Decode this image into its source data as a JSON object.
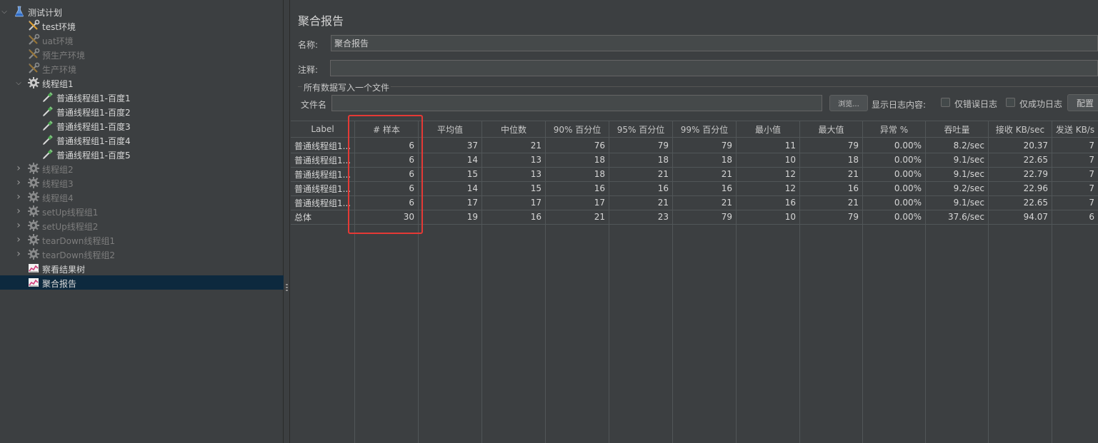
{
  "tree": {
    "items": [
      {
        "label": "测试计划",
        "icon": "flask-icon",
        "level": 0,
        "expanded": true,
        "disabled": false
      },
      {
        "label": "test环境",
        "icon": "wrench-screwdriver-icon",
        "level": 1,
        "disabled": false
      },
      {
        "label": "uat环境",
        "icon": "wrench-screwdriver-icon",
        "level": 1,
        "disabled": true
      },
      {
        "label": "预生产环境",
        "icon": "wrench-screwdriver-icon",
        "level": 1,
        "disabled": true
      },
      {
        "label": "生产环境",
        "icon": "wrench-screwdriver-icon",
        "level": 1,
        "disabled": true
      },
      {
        "label": "线程组1",
        "icon": "gear-icon",
        "level": 1,
        "expanded": true,
        "disabled": false
      },
      {
        "label": "普通线程组1-百度1",
        "icon": "pipette-icon",
        "level": 2,
        "disabled": false
      },
      {
        "label": "普通线程组1-百度2",
        "icon": "pipette-icon",
        "level": 2,
        "disabled": false
      },
      {
        "label": "普通线程组1-百度3",
        "icon": "pipette-icon",
        "level": 2,
        "disabled": false
      },
      {
        "label": "普通线程组1-百度4",
        "icon": "pipette-icon",
        "level": 2,
        "disabled": false
      },
      {
        "label": "普通线程组1-百度5",
        "icon": "pipette-icon",
        "level": 2,
        "disabled": false
      },
      {
        "label": "线程组2",
        "icon": "gear-icon",
        "level": 1,
        "collapsed": true,
        "disabled": true
      },
      {
        "label": "线程组3",
        "icon": "gear-icon",
        "level": 1,
        "collapsed": true,
        "disabled": true
      },
      {
        "label": "线程组4",
        "icon": "gear-icon",
        "level": 1,
        "collapsed": true,
        "disabled": true
      },
      {
        "label": "setUp线程组1",
        "icon": "gear-icon",
        "level": 1,
        "collapsed": true,
        "disabled": true
      },
      {
        "label": "setUp线程组2",
        "icon": "gear-icon",
        "level": 1,
        "collapsed": true,
        "disabled": true
      },
      {
        "label": "tearDown线程组1",
        "icon": "gear-icon",
        "level": 1,
        "collapsed": true,
        "disabled": true
      },
      {
        "label": "tearDown线程组2",
        "icon": "gear-icon",
        "level": 1,
        "collapsed": true,
        "disabled": true
      },
      {
        "label": "察看结果树",
        "icon": "chart-icon",
        "level": 1,
        "disabled": false
      },
      {
        "label": "聚合报告",
        "icon": "chart-icon",
        "level": 1,
        "disabled": false,
        "selected": true
      }
    ]
  },
  "panel": {
    "title": "聚合报告",
    "name_label": "名称:",
    "name_value": "聚合报告",
    "comment_label": "注释:",
    "comment_value": "",
    "group_title": "所有数据写入一个文件",
    "filename_label": "文件名",
    "filename_value": "",
    "browse_button": "浏览...",
    "log_display_label": "显示日志内容:",
    "errors_only_label": "仅错误日志",
    "success_only_label": "仅成功日志",
    "configure_button": "配置"
  },
  "table": {
    "headers": [
      "Label",
      "# 样本",
      "平均值",
      "中位数",
      "90% 百分位",
      "95% 百分位",
      "99% 百分位",
      "最小值",
      "最大值",
      "异常 %",
      "吞吐量",
      "接收 KB/sec",
      "发送 KB/s"
    ],
    "rows": [
      [
        "普通线程组1...",
        "6",
        "37",
        "21",
        "76",
        "79",
        "79",
        "11",
        "79",
        "0.00%",
        "8.2/sec",
        "20.37",
        "7"
      ],
      [
        "普通线程组1...",
        "6",
        "14",
        "13",
        "18",
        "18",
        "18",
        "10",
        "18",
        "0.00%",
        "9.1/sec",
        "22.65",
        "7"
      ],
      [
        "普通线程组1...",
        "6",
        "15",
        "13",
        "18",
        "21",
        "21",
        "12",
        "21",
        "0.00%",
        "9.1/sec",
        "22.79",
        "7"
      ],
      [
        "普通线程组1...",
        "6",
        "14",
        "15",
        "16",
        "16",
        "16",
        "12",
        "16",
        "0.00%",
        "9.2/sec",
        "22.96",
        "7"
      ],
      [
        "普通线程组1...",
        "6",
        "17",
        "17",
        "17",
        "21",
        "21",
        "16",
        "21",
        "0.00%",
        "9.1/sec",
        "22.65",
        "7"
      ],
      [
        "总体",
        "30",
        "19",
        "16",
        "21",
        "23",
        "79",
        "10",
        "79",
        "0.00%",
        "37.6/sec",
        "94.07",
        "6"
      ]
    ]
  },
  "colors": {
    "highlight": "#e53935",
    "selected_row": "#0d293e"
  }
}
